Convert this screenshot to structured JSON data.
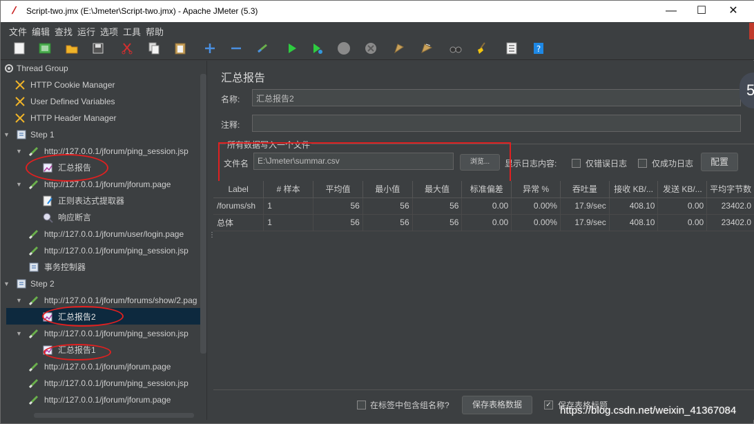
{
  "window": {
    "title": "Script-two.jmx (E:\\Jmeter\\Script-two.jmx) - Apache JMeter (5.3)",
    "minimize": "—",
    "maximize": "☐",
    "close": "✕"
  },
  "menu": [
    "文件",
    "编辑",
    "查找",
    "运行",
    "选项",
    "工具",
    "帮助"
  ],
  "tree": [
    {
      "label": "Thread Group",
      "icon": "thread-group-icon"
    },
    {
      "label": "HTTP Cookie Manager",
      "icon": "config-scissors-icon"
    },
    {
      "label": "User Defined Variables",
      "icon": "config-scissors-icon"
    },
    {
      "label": "HTTP Header Manager",
      "icon": "config-scissors-icon"
    },
    {
      "label": "Step 1",
      "icon": "controller-icon"
    },
    {
      "label": "http://127.0.0.1/jforum/ping_session.jsp",
      "icon": "sampler-pipette-icon"
    },
    {
      "label": "汇总报告",
      "icon": "listener-icon"
    },
    {
      "label": "http://127.0.0.1/jforum/jforum.page",
      "icon": "sampler-pipette-icon"
    },
    {
      "label": "正则表达式提取器",
      "icon": "extractor-icon"
    },
    {
      "label": "响应断言",
      "icon": "assertion-icon"
    },
    {
      "label": "http://127.0.0.1/jforum/user/login.page",
      "icon": "sampler-pipette-icon"
    },
    {
      "label": "http://127.0.0.1/jforum/ping_session.jsp",
      "icon": "sampler-pipette-icon"
    },
    {
      "label": "事务控制器",
      "icon": "controller-icon"
    },
    {
      "label": "Step 2",
      "icon": "controller-icon"
    },
    {
      "label": "http://127.0.0.1/jforum/forums/show/2.pag",
      "icon": "sampler-pipette-icon"
    },
    {
      "label": "汇总报告2",
      "icon": "listener-icon"
    },
    {
      "label": "http://127.0.0.1/jforum/ping_session.jsp",
      "icon": "sampler-pipette-icon"
    },
    {
      "label": "汇总报告1",
      "icon": "listener-icon"
    },
    {
      "label": "http://127.0.0.1/jforum/jforum.page",
      "icon": "sampler-pipette-icon"
    },
    {
      "label": "http://127.0.0.1/jforum/ping_session.jsp",
      "icon": "sampler-pipette-icon"
    },
    {
      "label": "http://127.0.0.1/jforum/jforum.page",
      "icon": "sampler-pipette-icon"
    }
  ],
  "panel": {
    "title": "汇总报告",
    "name_label": "名称:",
    "name_value": "汇总报告2",
    "comment_label": "注释:",
    "comment_value": "",
    "section_label": "所有数据写入一个文件",
    "file_label": "文件名",
    "file_value": "E:\\Jmeter\\summar.csv",
    "browse_button": "浏览...",
    "log_content_label": "显示日志内容:",
    "errors_only": "仅错误日志",
    "success_only": "仅成功日志",
    "configure_button": "配置",
    "include_group_name": "在标签中包含组名称?",
    "save_table_button": "保存表格数据",
    "save_table_header": "保存表格标题"
  },
  "table": {
    "headers": [
      "Label",
      "# 样本",
      "平均值",
      "最小值",
      "最大值",
      "标准偏差",
      "异常 %",
      "吞吐量",
      "接收 KB/...",
      "发送 KB/...",
      "平均字节数"
    ],
    "rows": [
      [
        "/forums/sh",
        "1",
        "56",
        "56",
        "56",
        "0.00",
        "0.00%",
        "17.9/sec",
        "408.10",
        "0.00",
        "23402.0"
      ],
      [
        "总体",
        "1",
        "56",
        "56",
        "56",
        "0.00",
        "0.00%",
        "17.9/sec",
        "408.10",
        "0.00",
        "23402.0"
      ]
    ]
  },
  "watermark": "https://blog.csdn.net/weixin_41367084",
  "badge": "5",
  "colors": {
    "background": "#3c3f41",
    "selected": "#0d293e",
    "annotation": "#e02020"
  }
}
